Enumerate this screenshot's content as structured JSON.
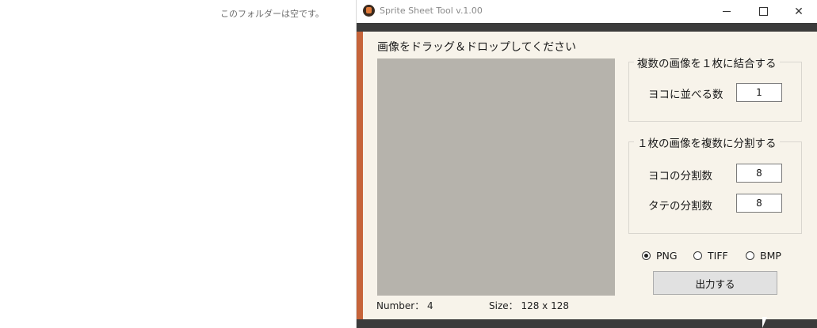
{
  "explorer": {
    "empty_message": "このフォルダーは空です。"
  },
  "window": {
    "title": "Sprite Sheet Tool v.1.00"
  },
  "drop": {
    "instruction": "画像をドラッグ＆ドロップしてください",
    "number_text": "Number： 4",
    "size_text": "Size： 128 x 128"
  },
  "combine": {
    "legend": "複数の画像を１枚に結合する",
    "horizontal_label": "ヨコに並べる数",
    "horizontal_value": "1"
  },
  "split": {
    "legend": "１枚の画像を複数に分割する",
    "horizontal_label": "ヨコの分割数",
    "horizontal_value": "8",
    "vertical_label": "タテの分割数",
    "vertical_value": "8"
  },
  "format": {
    "options": [
      "PNG",
      "TIFF",
      "BMP"
    ],
    "selected": "PNG"
  },
  "export_label": "出力する",
  "colors": {
    "accent": "#c6643a",
    "band": "#3b3b3b",
    "panel": "#f7f3ea",
    "drop_area": "#b6b3ac"
  }
}
